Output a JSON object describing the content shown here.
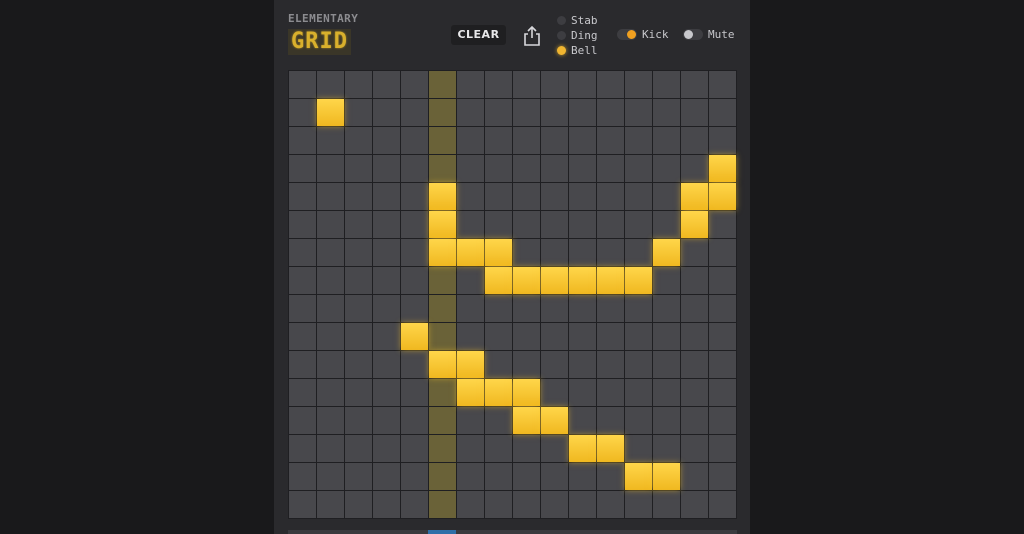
{
  "header": {
    "brand_sub": "ELEMENTARY",
    "brand_logo": "GRID",
    "clear_label": "CLEAR",
    "share_icon": "share-icon"
  },
  "sounds": {
    "options": [
      "Stab",
      "Ding",
      "Bell"
    ],
    "selected": "Bell"
  },
  "toggles": {
    "kick": {
      "label": "Kick",
      "on": true
    },
    "mute": {
      "label": "Mute",
      "on": false
    }
  },
  "grid": {
    "rows": 16,
    "cols": 16,
    "playhead_col": 5,
    "active_cells": [
      [
        1,
        1
      ],
      [
        3,
        15
      ],
      [
        4,
        5
      ],
      [
        4,
        14
      ],
      [
        4,
        15
      ],
      [
        5,
        5
      ],
      [
        5,
        14
      ],
      [
        6,
        5
      ],
      [
        6,
        6
      ],
      [
        6,
        7
      ],
      [
        6,
        13
      ],
      [
        7,
        7
      ],
      [
        7,
        8
      ],
      [
        7,
        9
      ],
      [
        7,
        10
      ],
      [
        7,
        11
      ],
      [
        7,
        12
      ],
      [
        9,
        4
      ],
      [
        10,
        5
      ],
      [
        10,
        6
      ],
      [
        11,
        6
      ],
      [
        11,
        7
      ],
      [
        11,
        8
      ],
      [
        12,
        8
      ],
      [
        12,
        9
      ],
      [
        13,
        10
      ],
      [
        13,
        11
      ],
      [
        14,
        12
      ],
      [
        14,
        13
      ]
    ]
  },
  "colors": {
    "active": "#f5c22a",
    "cell": "#48484c",
    "playhead": "#6a6238",
    "background": "#2a2a2d"
  }
}
